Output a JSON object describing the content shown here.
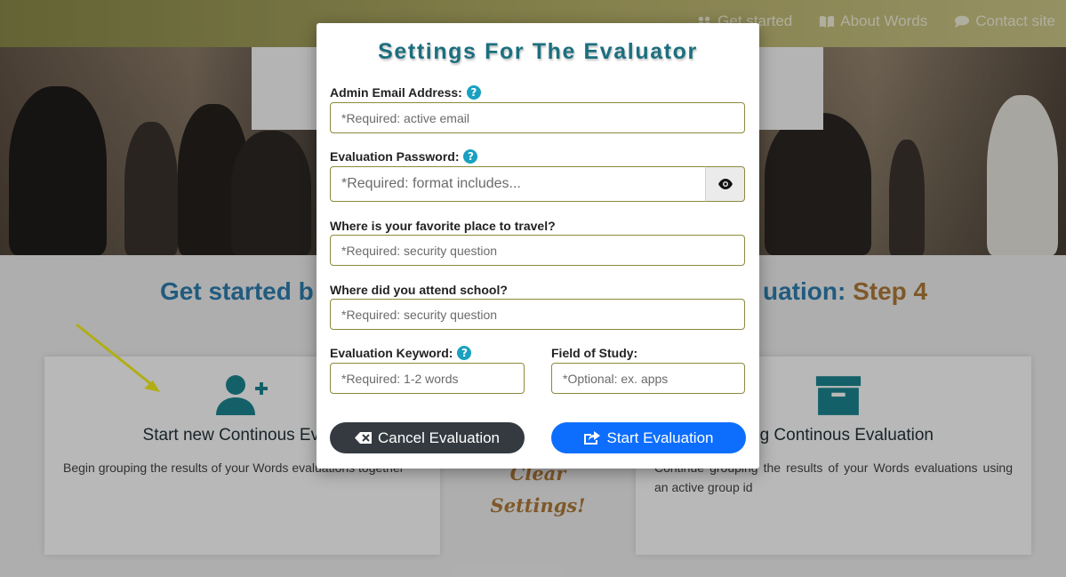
{
  "nav": {
    "items": [
      {
        "label": "Get started",
        "icon": "users-icon"
      },
      {
        "label": "About Words",
        "icon": "book-icon"
      },
      {
        "label": "Contact site",
        "icon": "comment-icon"
      }
    ]
  },
  "page": {
    "heading_left": "Get started b",
    "heading_right_prefix": "uation: ",
    "heading_right_step": "Step 4",
    "left_card": {
      "title": "Start new Continous Evalu",
      "desc": "Begin grouping the results of your Words evaluations together",
      "icon": "user-plus-icon"
    },
    "right_card": {
      "title": "sting Continous Evaluation",
      "desc": "Continue grouping the results of your Words evaluations using an active group id",
      "icon": "archive-icon"
    },
    "clear_line1": "Clear",
    "clear_line2": "Settings!"
  },
  "modal": {
    "title": "Settings For The Evaluator",
    "email": {
      "label": "Admin Email Address:",
      "placeholder": "*Required: active email"
    },
    "password": {
      "label": "Evaluation Password:",
      "placeholder": "*Required: format includes..."
    },
    "travel": {
      "label": "Where is your favorite place to travel?",
      "placeholder": "*Required: security question"
    },
    "school": {
      "label": "Where did you attend school?",
      "placeholder": "*Required: security question"
    },
    "keyword": {
      "label": "Evaluation Keyword:",
      "placeholder": "*Required: 1-2 words"
    },
    "field_of_study": {
      "label": "Field of Study:",
      "placeholder": "*Optional: ex. apps"
    },
    "cancel_label": "Cancel Evaluation",
    "start_label": "Start Evaluation",
    "help_glyph": "?"
  },
  "colors": {
    "accent_teal": "#1b6f7e",
    "primary_blue": "#0d6efd",
    "dark_button": "#343a40",
    "step_brown": "#b07a3a"
  }
}
